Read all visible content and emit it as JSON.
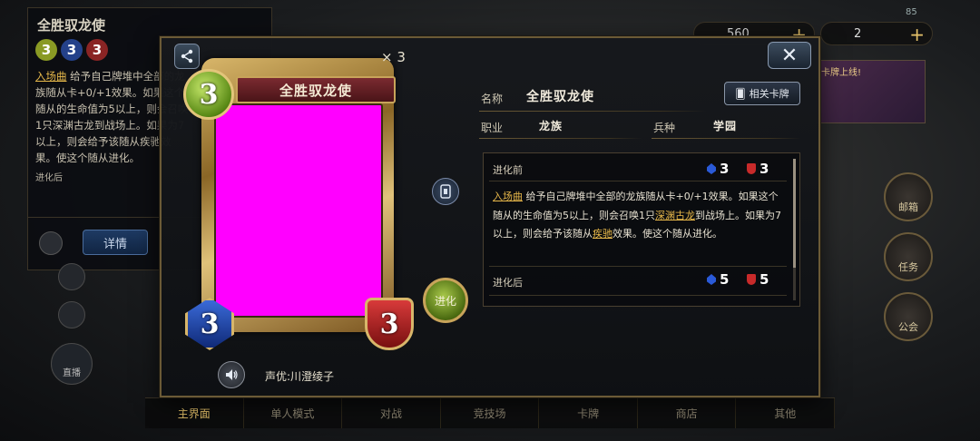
{
  "background": {
    "panel_title": "全胜驭龙使",
    "costs": [
      "3",
      "3",
      "3"
    ],
    "text_kw": "入场曲",
    "text": "给予自己牌堆中全部的龙族随从卡+0/+1效果。如果这个随从的生命值为5以上，则会召唤1只深渊古龙到战场上。如果为7以上，则会给予该随从疾驰效果。使这个随从进化。",
    "evolve_label": "进化后",
    "detail_button": "详情",
    "live_label": "直播",
    "currency_1": "560",
    "currency_2": "2",
    "signal": "85",
    "banner_text": "卡牌上线!",
    "right_buttons": [
      "邮箱",
      "任务",
      "公会"
    ],
    "nav": [
      "主界面",
      "单人模式",
      "对战",
      "竞技场",
      "卡牌",
      "商店",
      "其他"
    ]
  },
  "modal": {
    "count": "× 3",
    "card": {
      "name": "全胜驭龙使",
      "cost": "3",
      "attack": "3",
      "defense": "3",
      "art_color": "#ff00ff"
    },
    "voice_actor": "声优:川澄绫子",
    "evolve_button": "进化",
    "name_label": "名称",
    "name_value": "全胜驭龙使",
    "related_button": "相关卡牌",
    "class_label": "职业",
    "class_value": "龙族",
    "trait_label": "兵种",
    "trait_value": "学园",
    "before_label": "进化前",
    "before_attack": "3",
    "before_defense": "3",
    "effect_kw1": "入场曲",
    "effect_part1": " 给予自己牌堆中全部的龙族随从卡+0/+1效果。如果这个随从的生命值为5以上，则会召唤1只",
    "effect_kw2": "深渊古龙",
    "effect_part2": "到战场上。如果为7以上，则会给予该随从",
    "effect_kw3": "疾驰",
    "effect_part3": "效果。使这个随从进化。",
    "after_label": "进化后",
    "after_attack": "5",
    "after_defense": "5"
  }
}
